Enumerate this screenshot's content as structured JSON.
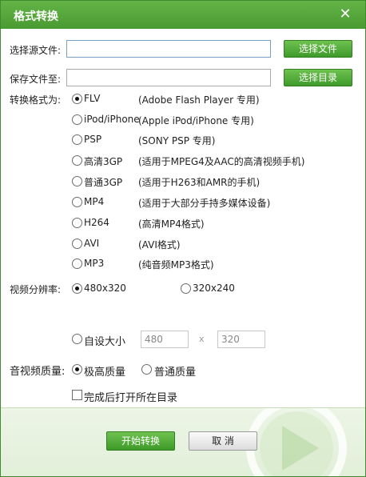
{
  "window": {
    "title": "格式转换",
    "close_symbol": "✕"
  },
  "source": {
    "label": "选择源文件:",
    "value": "",
    "button": "选择文件"
  },
  "save": {
    "label": "保存文件至:",
    "value": "",
    "button": "选择目录"
  },
  "format": {
    "label": "转换格式为:",
    "selected": "FLV",
    "options": [
      {
        "name": "FLV",
        "desc": "(Adobe Flash Player 专用)"
      },
      {
        "name": "iPod/iPhone",
        "desc": "(Apple iPod/iPhone 专用)"
      },
      {
        "name": "PSP",
        "desc": "(SONY PSP 专用)"
      },
      {
        "name": "高清3GP",
        "desc": "(适用于MPEG4及AAC的高清视频手机)"
      },
      {
        "name": "普通3GP",
        "desc": "(适用于H263和AMR的手机)"
      },
      {
        "name": "MP4",
        "desc": "(适用于大部分手持多媒体设备)"
      },
      {
        "name": "H264",
        "desc": "(高清MP4格式)"
      },
      {
        "name": "AVI",
        "desc": "(AVI格式)"
      },
      {
        "name": "MP3",
        "desc": "(纯音频MP3格式)"
      }
    ]
  },
  "resolution": {
    "label": "视频分辨率:",
    "options": [
      "480x320",
      "320x240"
    ],
    "selected": "480x320",
    "custom_label": "自设大小",
    "custom_width": "480",
    "custom_height": "320",
    "separator": "x"
  },
  "quality": {
    "label": "音视频质量:",
    "options": [
      "极高质量",
      "普通质量"
    ],
    "selected": "极高质量"
  },
  "open_after": {
    "label": "完成后打开所在目录",
    "checked": false
  },
  "footer": {
    "start_label": "开始转换",
    "cancel_label": "取 消"
  },
  "colors": {
    "accent": "#4a9a33",
    "footer_bg": "#e6f1de"
  }
}
